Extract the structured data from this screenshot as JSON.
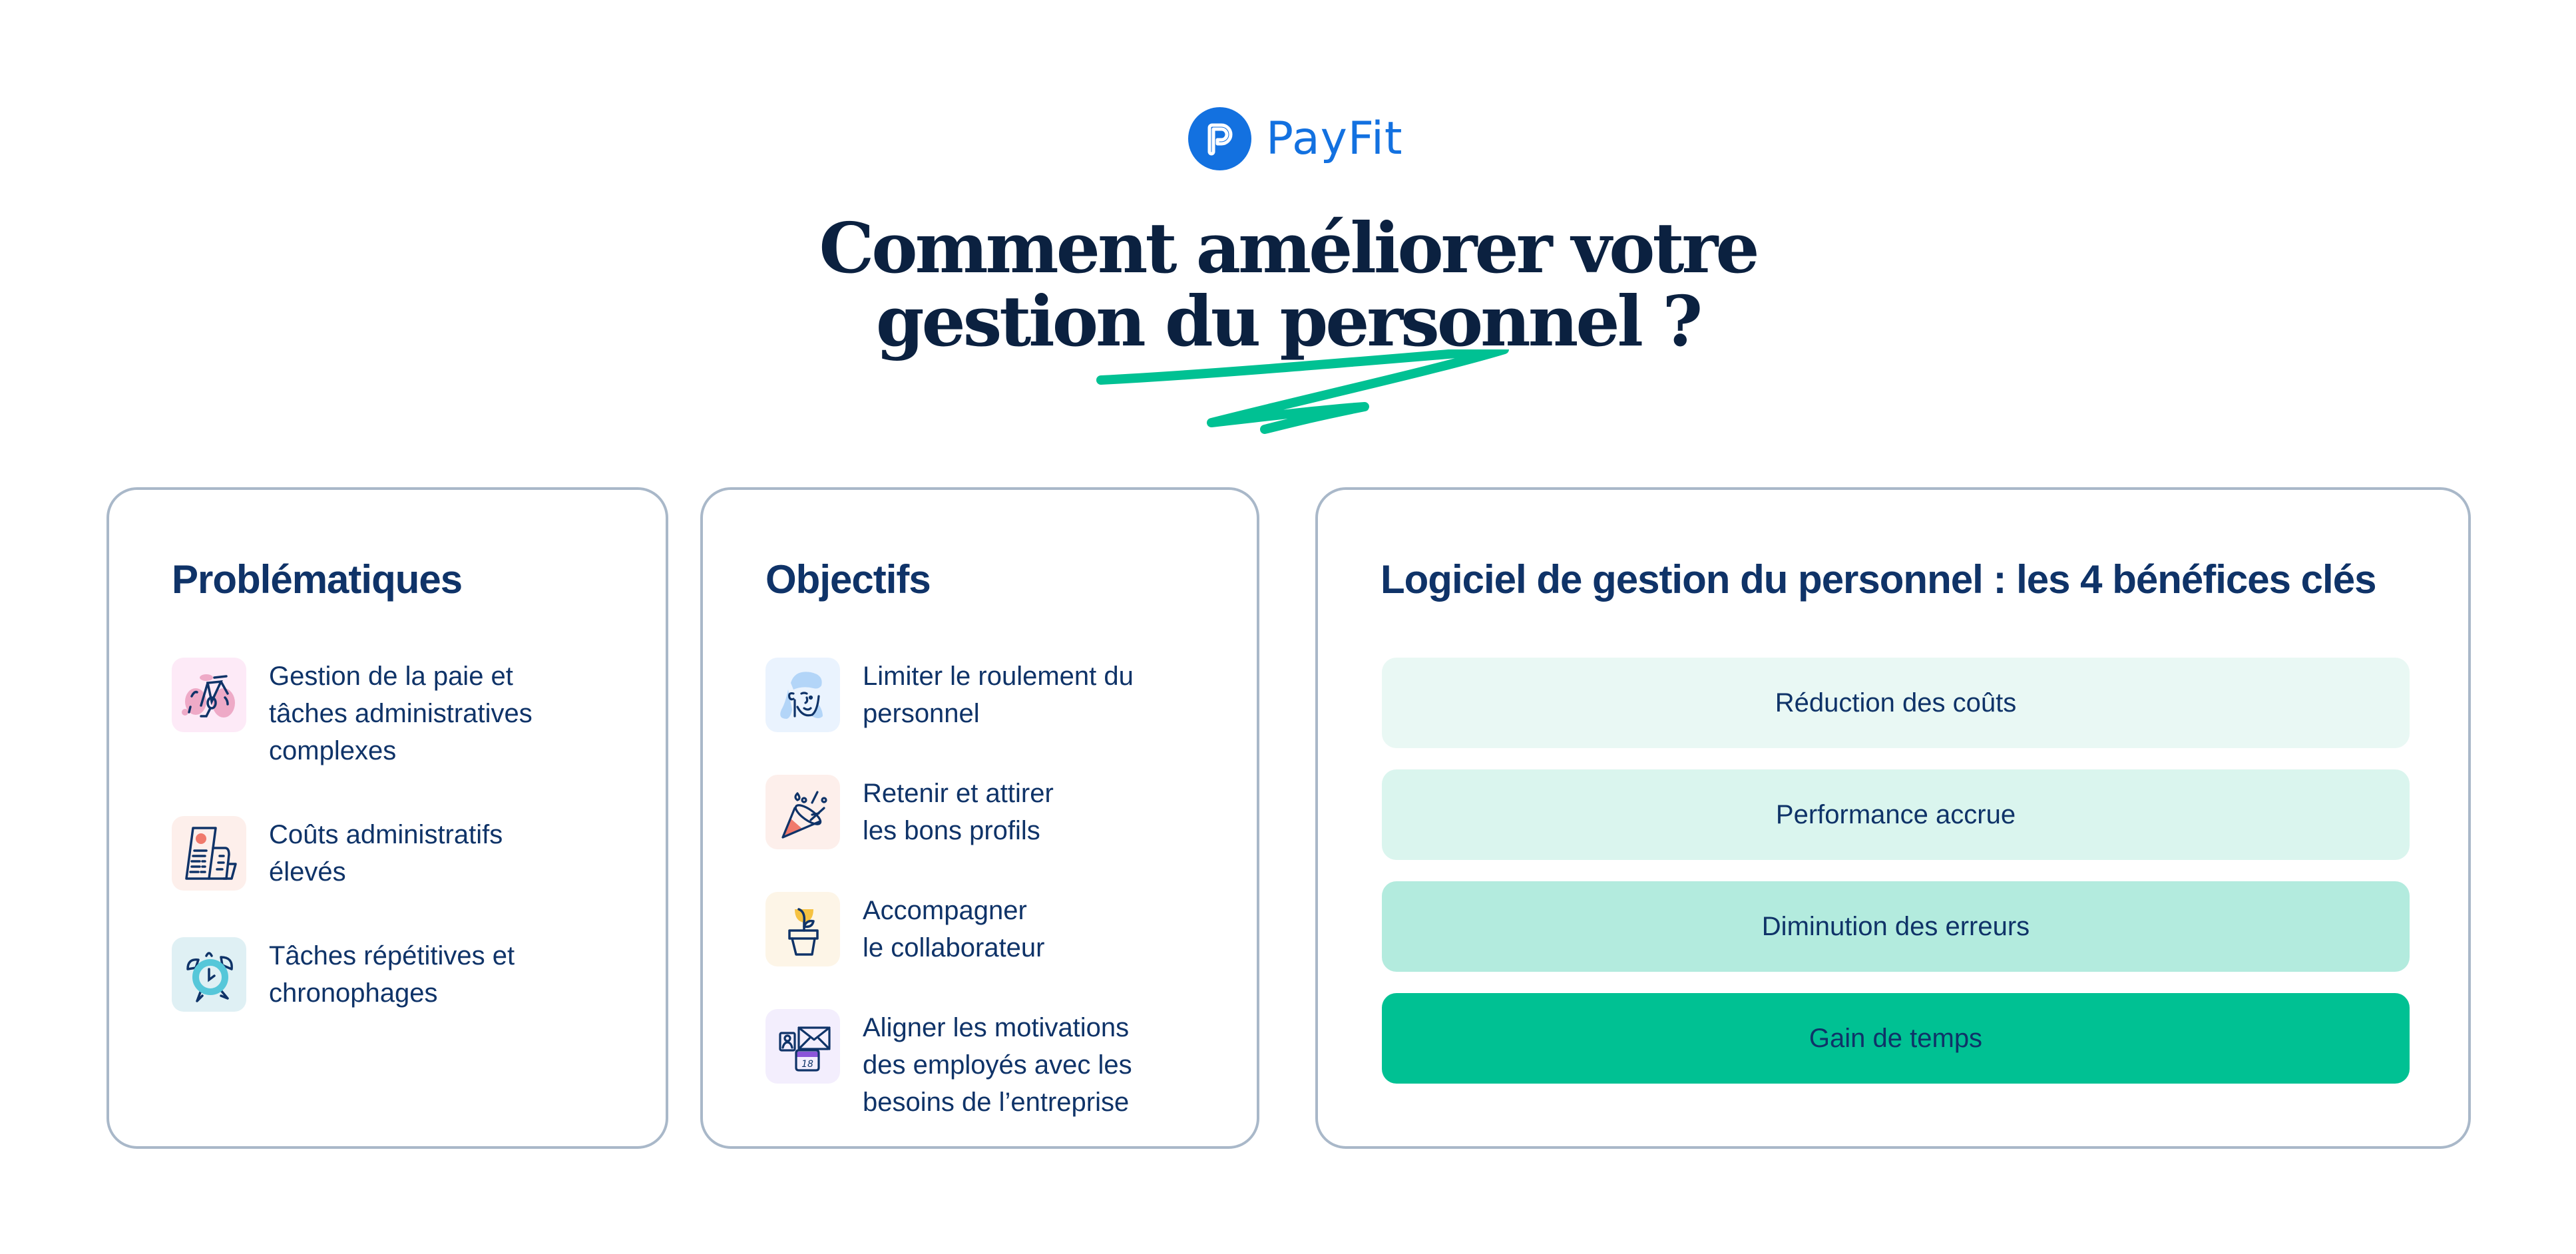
{
  "brand": {
    "name": "PayFit",
    "logo_icon": "payfit-p-logo-icon",
    "color": "#1371e0"
  },
  "headline": {
    "line1": "Comment améliorer votre",
    "line2": "gestion du personnel ?",
    "underline_color": "#00c193"
  },
  "cards": {
    "problems": {
      "title": "Problématiques",
      "items": [
        {
          "icon": "bicycle-icon",
          "icon_bg": "#fdeaf7",
          "line1": "Gestion de la paie et",
          "line2": "tâches administratives",
          "line3": "complexes"
        },
        {
          "icon": "receipt-scroll-icon",
          "icon_bg": "#fdefeb",
          "line1": "Coûts administratifs",
          "line2": "élevés"
        },
        {
          "icon": "alarm-clock-icon",
          "icon_bg": "#dff0f4",
          "line1": "Tâches répétitives et",
          "line2": "chronophages"
        }
      ]
    },
    "objectives": {
      "title": "Objectifs",
      "items": [
        {
          "icon": "person-face-icon",
          "icon_bg": "#eaf3fe",
          "line1": "Limiter le roulement du",
          "line2": "personnel"
        },
        {
          "icon": "party-popper-icon",
          "icon_bg": "#fdefeb",
          "line1": "Retenir et attirer",
          "line2": "les bons profils"
        },
        {
          "icon": "flower-pot-icon",
          "icon_bg": "#fdf5e7",
          "line1": "Accompagner",
          "line2": "le collaborateur"
        },
        {
          "icon": "contact-mail-calendar-icon",
          "icon_bg": "#f3eefd",
          "line1": "Aligner les motivations",
          "line2": "des employés avec les",
          "line3": "besoins de l’entreprise",
          "calendar_day": "18"
        }
      ]
    },
    "benefits": {
      "title": "Logiciel de gestion du personnel  : les 4 bénéfices clés",
      "items": [
        {
          "label": "Réduction des coûts",
          "bg": "#e9f8f4"
        },
        {
          "label": "Performance accrue",
          "bg": "#daf5ee"
        },
        {
          "label": "Diminution des erreurs",
          "bg": "#b3ebde"
        },
        {
          "label": "Gain de temps",
          "bg": "#00c193"
        }
      ]
    }
  }
}
